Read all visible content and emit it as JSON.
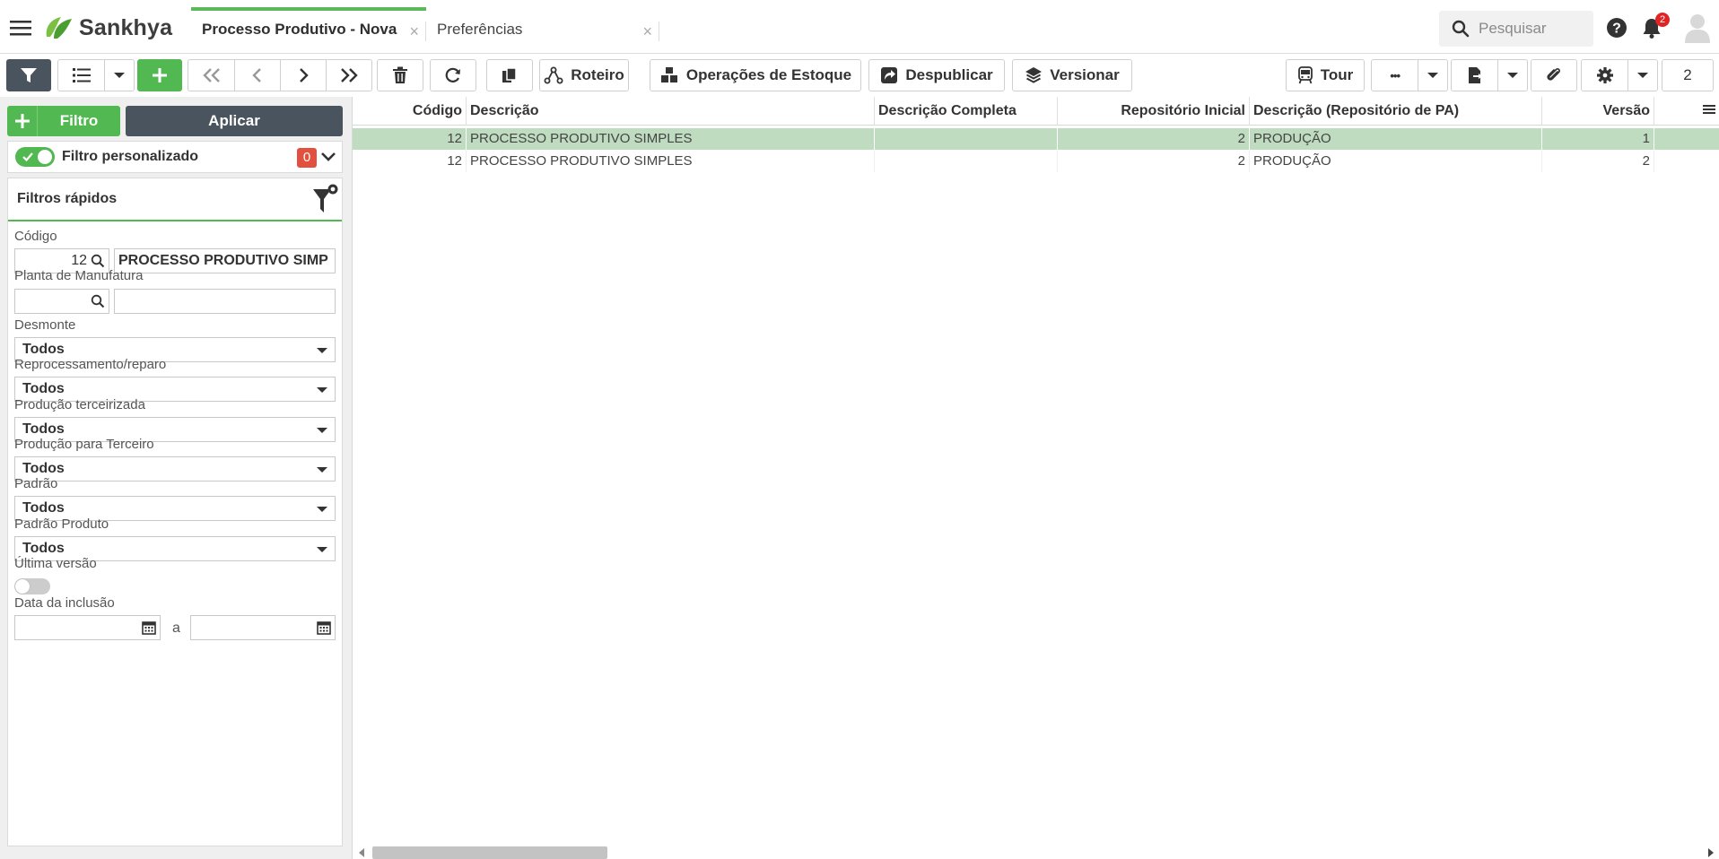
{
  "topbar": {
    "brand": "Sankhya",
    "tabs": [
      {
        "label": "Processo Produtivo - Nova",
        "close": "×"
      },
      {
        "label": "Preferências",
        "close": "×"
      }
    ],
    "search_placeholder": "Pesquisar",
    "notification_count": "2"
  },
  "toolbar": {
    "roteiro": "Roteiro",
    "operacoes": "Operações de Estoque",
    "despublicar": "Despublicar",
    "versionar": "Versionar",
    "tour": "Tour",
    "more": "•••",
    "page_number": "2"
  },
  "filters": {
    "filtro_label": "Filtro",
    "aplicar_label": "Aplicar",
    "custom_filter_label": "Filtro personalizado",
    "custom_filter_count": "0",
    "quick_filters_title": "Filtros rápidos",
    "codigo": {
      "label": "Código",
      "value": "12",
      "description": "PROCESSO PRODUTIVO SIMP"
    },
    "planta": {
      "label": "Planta de Manufatura",
      "value": "",
      "description": ""
    },
    "selects": [
      {
        "label": "Desmonte",
        "value": "Todos"
      },
      {
        "label": "Reprocessamento/reparo",
        "value": "Todos"
      },
      {
        "label": "Produção terceirizada",
        "value": "Todos"
      },
      {
        "label": "Produção para Terceiro",
        "value": "Todos"
      },
      {
        "label": "Padrão",
        "value": "Todos"
      },
      {
        "label": "Padrão Produto",
        "value": "Todos"
      }
    ],
    "ultima_versao_label": "Última versão",
    "data_inclusao_label": "Data da inclusão",
    "date_separator": "a"
  },
  "grid": {
    "columns": [
      "Código",
      "Descrição",
      "Descrição Completa",
      "Repositório Inicial",
      "Descrição (Repositório de PA)",
      "Versão"
    ],
    "rows": [
      {
        "codigo": "12",
        "descricao": "PROCESSO PRODUTIVO SIMPLES",
        "descricao_completa": "",
        "repositorio_inicial": "2",
        "descricao_repositorio": "PRODUÇÃO",
        "versao": "1",
        "selected": true
      },
      {
        "codigo": "12",
        "descricao": "PROCESSO PRODUTIVO SIMPLES",
        "descricao_completa": "",
        "repositorio_inicial": "2",
        "descricao_repositorio": "PRODUÇÃO",
        "versao": "2",
        "selected": false
      }
    ]
  },
  "colors": {
    "brand_green": "#52b852",
    "dark_button": "#4a545e",
    "selected_row": "#bfdcc0",
    "badge_red": "#e02424"
  }
}
